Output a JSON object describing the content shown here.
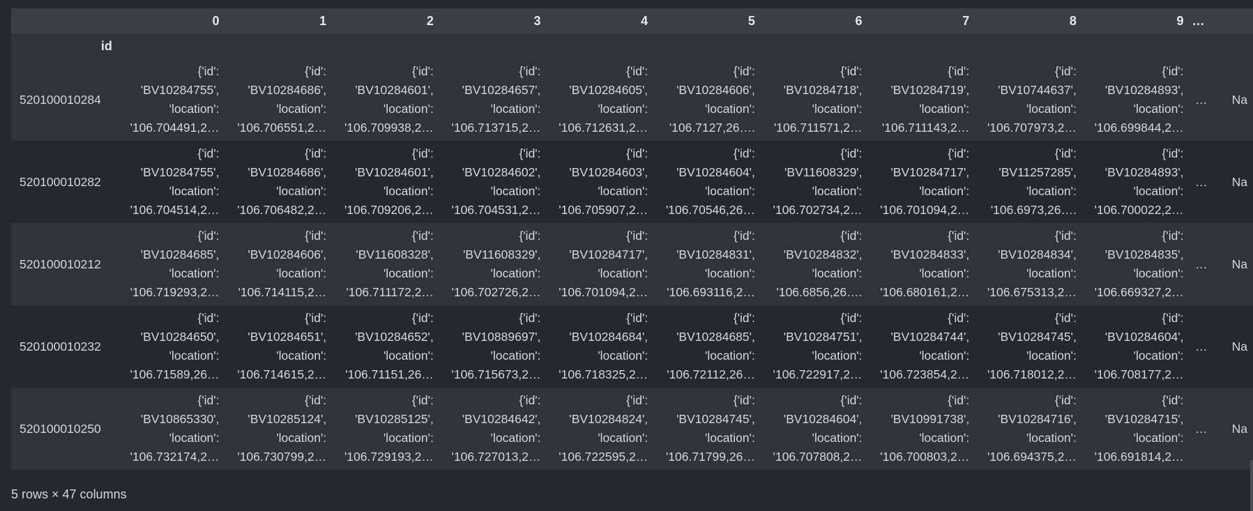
{
  "columns": [
    "0",
    "1",
    "2",
    "3",
    "4",
    "5",
    "6",
    "7",
    "8",
    "9",
    "…",
    ""
  ],
  "index_name": "id",
  "rows": [
    {
      "idx": "520100010284",
      "cells": [
        [
          "{'id':",
          "'BV10284755',",
          "'location':",
          "'106.704491,2…"
        ],
        [
          "{'id':",
          "'BV10284686',",
          "'location':",
          "'106.706551,2…"
        ],
        [
          "{'id':",
          "'BV10284601',",
          "'location':",
          "'106.709938,2…"
        ],
        [
          "{'id':",
          "'BV10284657',",
          "'location':",
          "'106.713715,2…"
        ],
        [
          "{'id':",
          "'BV10284605',",
          "'location':",
          "'106.712631,2…"
        ],
        [
          "{'id':",
          "'BV10284606',",
          "'location':",
          "'106.7127,26…."
        ],
        [
          "{'id':",
          "'BV10284718',",
          "'location':",
          "'106.711571,2…"
        ],
        [
          "{'id':",
          "'BV10284719',",
          "'location':",
          "'106.711143,2…"
        ],
        [
          "{'id':",
          "'BV10744637',",
          "'location':",
          "'106.707973,2…"
        ],
        [
          "{'id':",
          "'BV10284893',",
          "'location':",
          "'106.699844,2…"
        ]
      ],
      "ellipsis": "…",
      "last": "Na"
    },
    {
      "idx": "520100010282",
      "cells": [
        [
          "{'id':",
          "'BV10284755',",
          "'location':",
          "'106.704514,2…"
        ],
        [
          "{'id':",
          "'BV10284686',",
          "'location':",
          "'106.706482,2…"
        ],
        [
          "{'id':",
          "'BV10284601',",
          "'location':",
          "'106.709206,2…"
        ],
        [
          "{'id':",
          "'BV10284602',",
          "'location':",
          "'106.704531,2…"
        ],
        [
          "{'id':",
          "'BV10284603',",
          "'location':",
          "'106.705907,2…"
        ],
        [
          "{'id':",
          "'BV10284604',",
          "'location':",
          "'106.70546,26…"
        ],
        [
          "{'id':",
          "'BV11608329',",
          "'location':",
          "'106.702734,2…"
        ],
        [
          "{'id':",
          "'BV10284717',",
          "'location':",
          "'106.701094,2…"
        ],
        [
          "{'id':",
          "'BV11257285',",
          "'location':",
          "'106.6973,26…."
        ],
        [
          "{'id':",
          "'BV10284893',",
          "'location':",
          "'106.700022,2…"
        ]
      ],
      "ellipsis": "…",
      "last": "Na"
    },
    {
      "idx": "520100010212",
      "cells": [
        [
          "{'id':",
          "'BV10284685',",
          "'location':",
          "'106.719293,2…"
        ],
        [
          "{'id':",
          "'BV10284606',",
          "'location':",
          "'106.714115,2…"
        ],
        [
          "{'id':",
          "'BV11608328',",
          "'location':",
          "'106.711172,2…"
        ],
        [
          "{'id':",
          "'BV11608329',",
          "'location':",
          "'106.702726,2…"
        ],
        [
          "{'id':",
          "'BV10284717',",
          "'location':",
          "'106.701094,2…"
        ],
        [
          "{'id':",
          "'BV10284831',",
          "'location':",
          "'106.693116,2…"
        ],
        [
          "{'id':",
          "'BV10284832',",
          "'location':",
          "'106.6856,26…."
        ],
        [
          "{'id':",
          "'BV10284833',",
          "'location':",
          "'106.680161,2…"
        ],
        [
          "{'id':",
          "'BV10284834',",
          "'location':",
          "'106.675313,2…"
        ],
        [
          "{'id':",
          "'BV10284835',",
          "'location':",
          "'106.669327,2…"
        ]
      ],
      "ellipsis": "…",
      "last": "Na"
    },
    {
      "idx": "520100010232",
      "cells": [
        [
          "{'id':",
          "'BV10284650',",
          "'location':",
          "'106.71589,26…"
        ],
        [
          "{'id':",
          "'BV10284651',",
          "'location':",
          "'106.714615,2…"
        ],
        [
          "{'id':",
          "'BV10284652',",
          "'location':",
          "'106.71151,26…"
        ],
        [
          "{'id':",
          "'BV10889697',",
          "'location':",
          "'106.715673,2…"
        ],
        [
          "{'id':",
          "'BV10284684',",
          "'location':",
          "'106.718325,2…"
        ],
        [
          "{'id':",
          "'BV10284685',",
          "'location':",
          "'106.72112,26…"
        ],
        [
          "{'id':",
          "'BV10284751',",
          "'location':",
          "'106.722917,2…"
        ],
        [
          "{'id':",
          "'BV10284744',",
          "'location':",
          "'106.723854,2…"
        ],
        [
          "{'id':",
          "'BV10284745',",
          "'location':",
          "'106.718012,2…"
        ],
        [
          "{'id':",
          "'BV10284604',",
          "'location':",
          "'106.708177,2…"
        ]
      ],
      "ellipsis": "…",
      "last": "Na"
    },
    {
      "idx": "520100010250",
      "cells": [
        [
          "{'id':",
          "'BV10865330',",
          "'location':",
          "'106.732174,2…"
        ],
        [
          "{'id':",
          "'BV10285124',",
          "'location':",
          "'106.730799,2…"
        ],
        [
          "{'id':",
          "'BV10285125',",
          "'location':",
          "'106.729193,2…"
        ],
        [
          "{'id':",
          "'BV10284642',",
          "'location':",
          "'106.727013,2…"
        ],
        [
          "{'id':",
          "'BV10284824',",
          "'location':",
          "'106.722595,2…"
        ],
        [
          "{'id':",
          "'BV10284745',",
          "'location':",
          "'106.71799,26…"
        ],
        [
          "{'id':",
          "'BV10284604',",
          "'location':",
          "'106.707808,2…"
        ],
        [
          "{'id':",
          "'BV10991738',",
          "'location':",
          "'106.700803,2…"
        ],
        [
          "{'id':",
          "'BV10284716',",
          "'location':",
          "'106.694375,2…"
        ],
        [
          "{'id':",
          "'BV10284715',",
          "'location':",
          "'106.691814,2…"
        ]
      ],
      "ellipsis": "…",
      "last": "Na"
    }
  ],
  "footer": "5 rows × 47 columns"
}
